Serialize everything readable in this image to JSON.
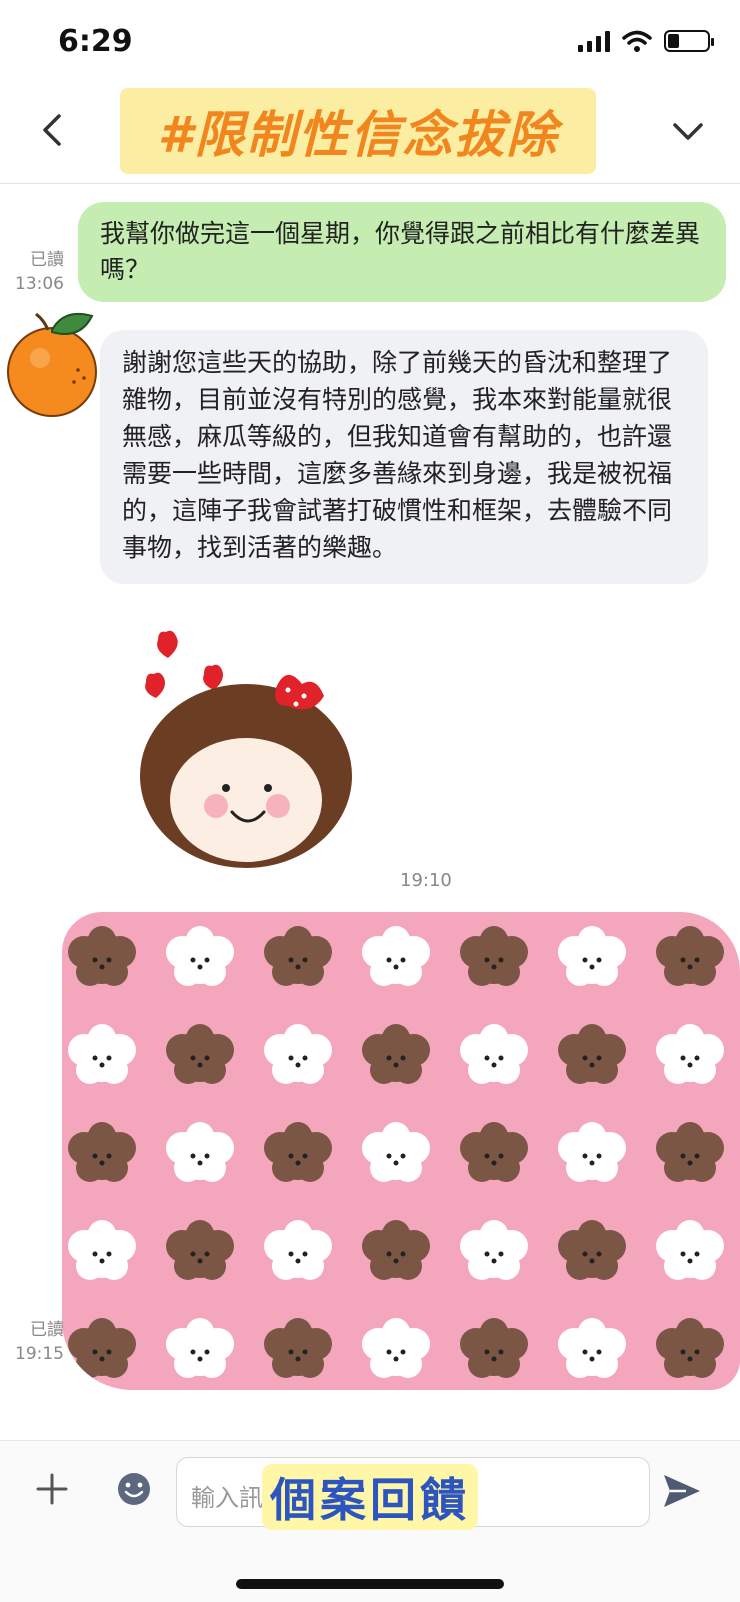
{
  "status": {
    "time": "6:29",
    "battery_level": 0.3
  },
  "header": {
    "title": "#限制性信念拔除"
  },
  "messages": {
    "outgoing_1": {
      "text": "我幫你做完這一個星期，你覺得跟之前相比有什麼差異嗎？",
      "read_label": "已讀",
      "time": "13:06"
    },
    "incoming_1": {
      "text": "謝謝您這些天的協助，除了前幾天的昏沈和整理了雜物，目前並沒有特別的感覺，我本來對能量就很無感，麻瓜等級的，但我知道會有幫助的，也許還需要一些時間，這麼多善緣來到身邊，我是被祝福的，這陣子我會試著打破慣性和框架，去體驗不同事物，找到活著的樂趣。"
    },
    "sticker_time": "19:10",
    "outgoing_2": {
      "read_label": "已讀",
      "time": "19:15"
    }
  },
  "input": {
    "placeholder": "輸入訊",
    "stamp": "個案回饋"
  },
  "icons": {
    "back": "chevron-left-icon",
    "menu": "chevron-down-icon",
    "plus": "plus-icon",
    "emoji": "smiley-icon",
    "send": "send-icon"
  },
  "colors": {
    "outgoing_bubble": "#c6edb1",
    "incoming_bubble": "#f0f1f4",
    "title_bg": "#fbeea2",
    "title_text": "#f1861f",
    "pattern_bg": "#f4a6bd",
    "stamp_text": "#2d55c0"
  }
}
